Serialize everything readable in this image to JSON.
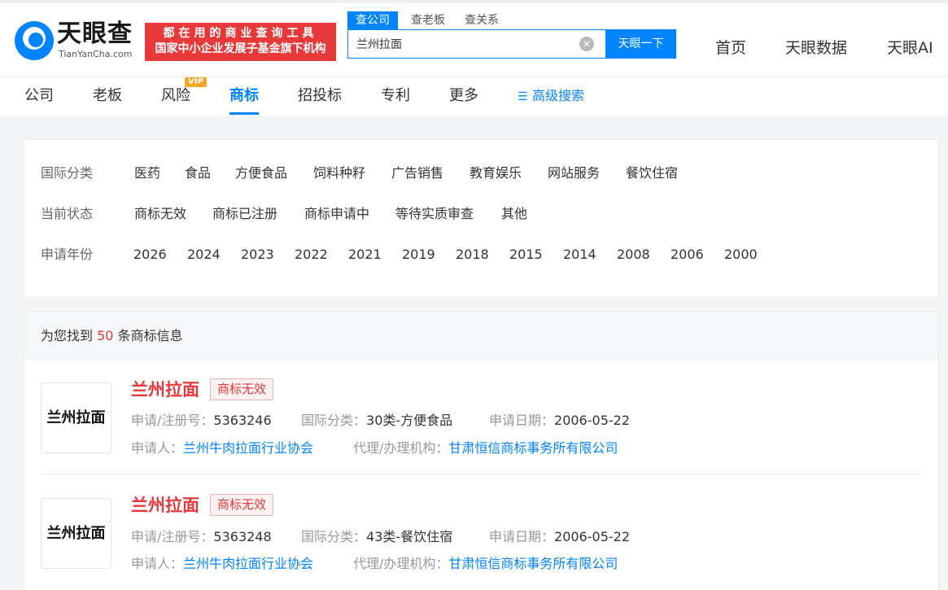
{
  "header": {
    "logo_cn": "天眼查",
    "logo_en": "TianYanCha.com",
    "slogan_line1": "都在用的商业查询工具",
    "slogan_line2": "国家中小企业发展子基金旗下机构",
    "search_tabs": [
      "查公司",
      "查老板",
      "查关系"
    ],
    "search_value": "兰州拉面",
    "search_button": "天眼一下",
    "nav": [
      "首页",
      "天眼数据",
      "天眼AI"
    ]
  },
  "subnav": {
    "items": [
      "公司",
      "老板",
      "风险",
      "商标",
      "招投标",
      "专利",
      "更多"
    ],
    "vip_badge": "VIP",
    "advanced": "高级搜索"
  },
  "filters": {
    "class_label": "国际分类",
    "class_options": [
      "医药",
      "食品",
      "方便食品",
      "饲料种籽",
      "广告销售",
      "教育娱乐",
      "网站服务",
      "餐饮住宿"
    ],
    "status_label": "当前状态",
    "status_options": [
      "商标无效",
      "商标已注册",
      "商标申请中",
      "等待实质审查",
      "其他"
    ],
    "year_label": "申请年份",
    "year_options": [
      "2026",
      "2024",
      "2023",
      "2022",
      "2021",
      "2019",
      "2018",
      "2015",
      "2014",
      "2008",
      "2006",
      "2000"
    ]
  },
  "results": {
    "prefix": "为您找到",
    "count": "50",
    "suffix": "条商标信息",
    "labels": {
      "reg_no": "申请/注册号：",
      "class": "国际分类：",
      "date": "申请日期：",
      "applicant": "申请人：",
      "agent": "代理/办理机构："
    },
    "items": [
      {
        "thumb_text": "兰州拉面",
        "name": "兰州拉面",
        "status": "商标无效",
        "reg_no": "5363246",
        "class": "30类-方便食品",
        "date": "2006-05-22",
        "applicant": "兰州牛肉拉面行业协会",
        "agent": "甘肃恒信商标事务所有限公司"
      },
      {
        "thumb_text": "兰州拉面",
        "name": "兰州拉面",
        "status": "商标无效",
        "reg_no": "5363248",
        "class": "43类-餐饮住宿",
        "date": "2006-05-22",
        "applicant": "兰州牛肉拉面行业协会",
        "agent": "甘肃恒信商标事务所有限公司"
      }
    ]
  },
  "colors": {
    "brand_blue": "#0084ff",
    "brand_red": "#e8393a"
  }
}
